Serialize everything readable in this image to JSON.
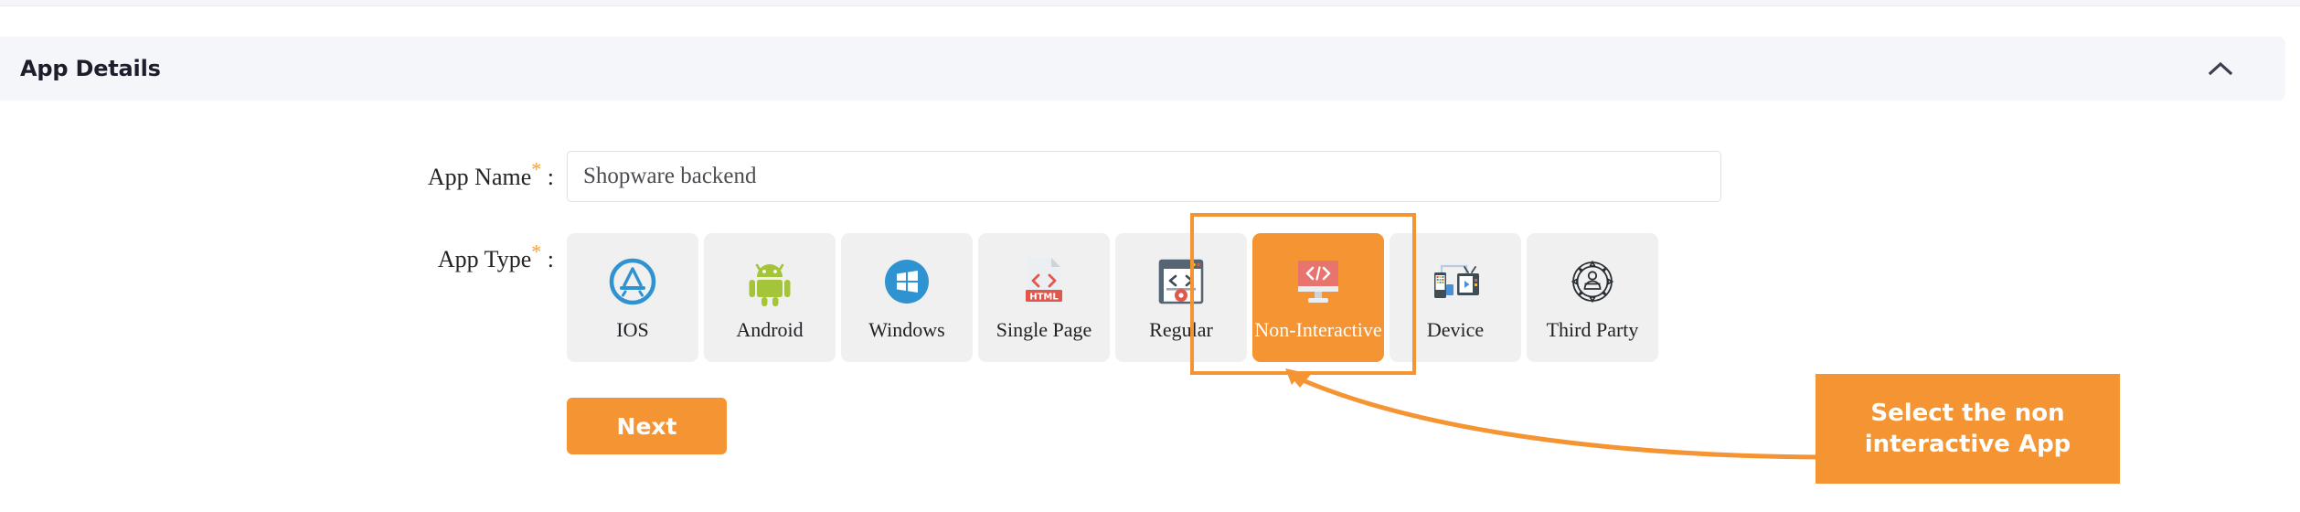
{
  "panel": {
    "title": "App Details",
    "collapse_icon": "chevron-up-icon"
  },
  "form": {
    "app_name": {
      "label": "App Name",
      "required_marker": "*",
      "colon": ":",
      "value": "Shopware backend",
      "placeholder": ""
    },
    "app_type": {
      "label": "App Type",
      "required_marker": "*",
      "colon": ":",
      "selected": "Non-Interactive",
      "options": [
        {
          "label": "IOS",
          "icon": "ios-appstore-icon",
          "selected": false
        },
        {
          "label": "Android",
          "icon": "android-robot-icon",
          "selected": false
        },
        {
          "label": "Windows",
          "icon": "windows-logo-icon",
          "selected": false
        },
        {
          "label": "Single Page",
          "icon": "html-document-icon",
          "selected": false
        },
        {
          "label": "Regular",
          "icon": "browser-code-gear-icon",
          "selected": false
        },
        {
          "label": "Non-Interactive",
          "icon": "monitor-code-icon",
          "selected": true
        },
        {
          "label": "Device",
          "icon": "device-phone-tv-icon",
          "selected": false
        },
        {
          "label": "Third Party",
          "icon": "gear-person-icon",
          "selected": false
        }
      ]
    }
  },
  "actions": {
    "next_label": "Next"
  },
  "annotation": {
    "callout_text": "Select the non\ninteractive  App",
    "highlight_target": "Non-Interactive",
    "arrow": "curved-arrow-pointing-left"
  },
  "colors": {
    "accent_orange": "#f59432",
    "header_bg": "#f5f6fa",
    "tile_bg": "#f0f0f0",
    "icon_red": "#e8746e",
    "icon_blue": "#2f93d1",
    "icon_green": "#a4c439",
    "required_star": "#f7a13a"
  }
}
